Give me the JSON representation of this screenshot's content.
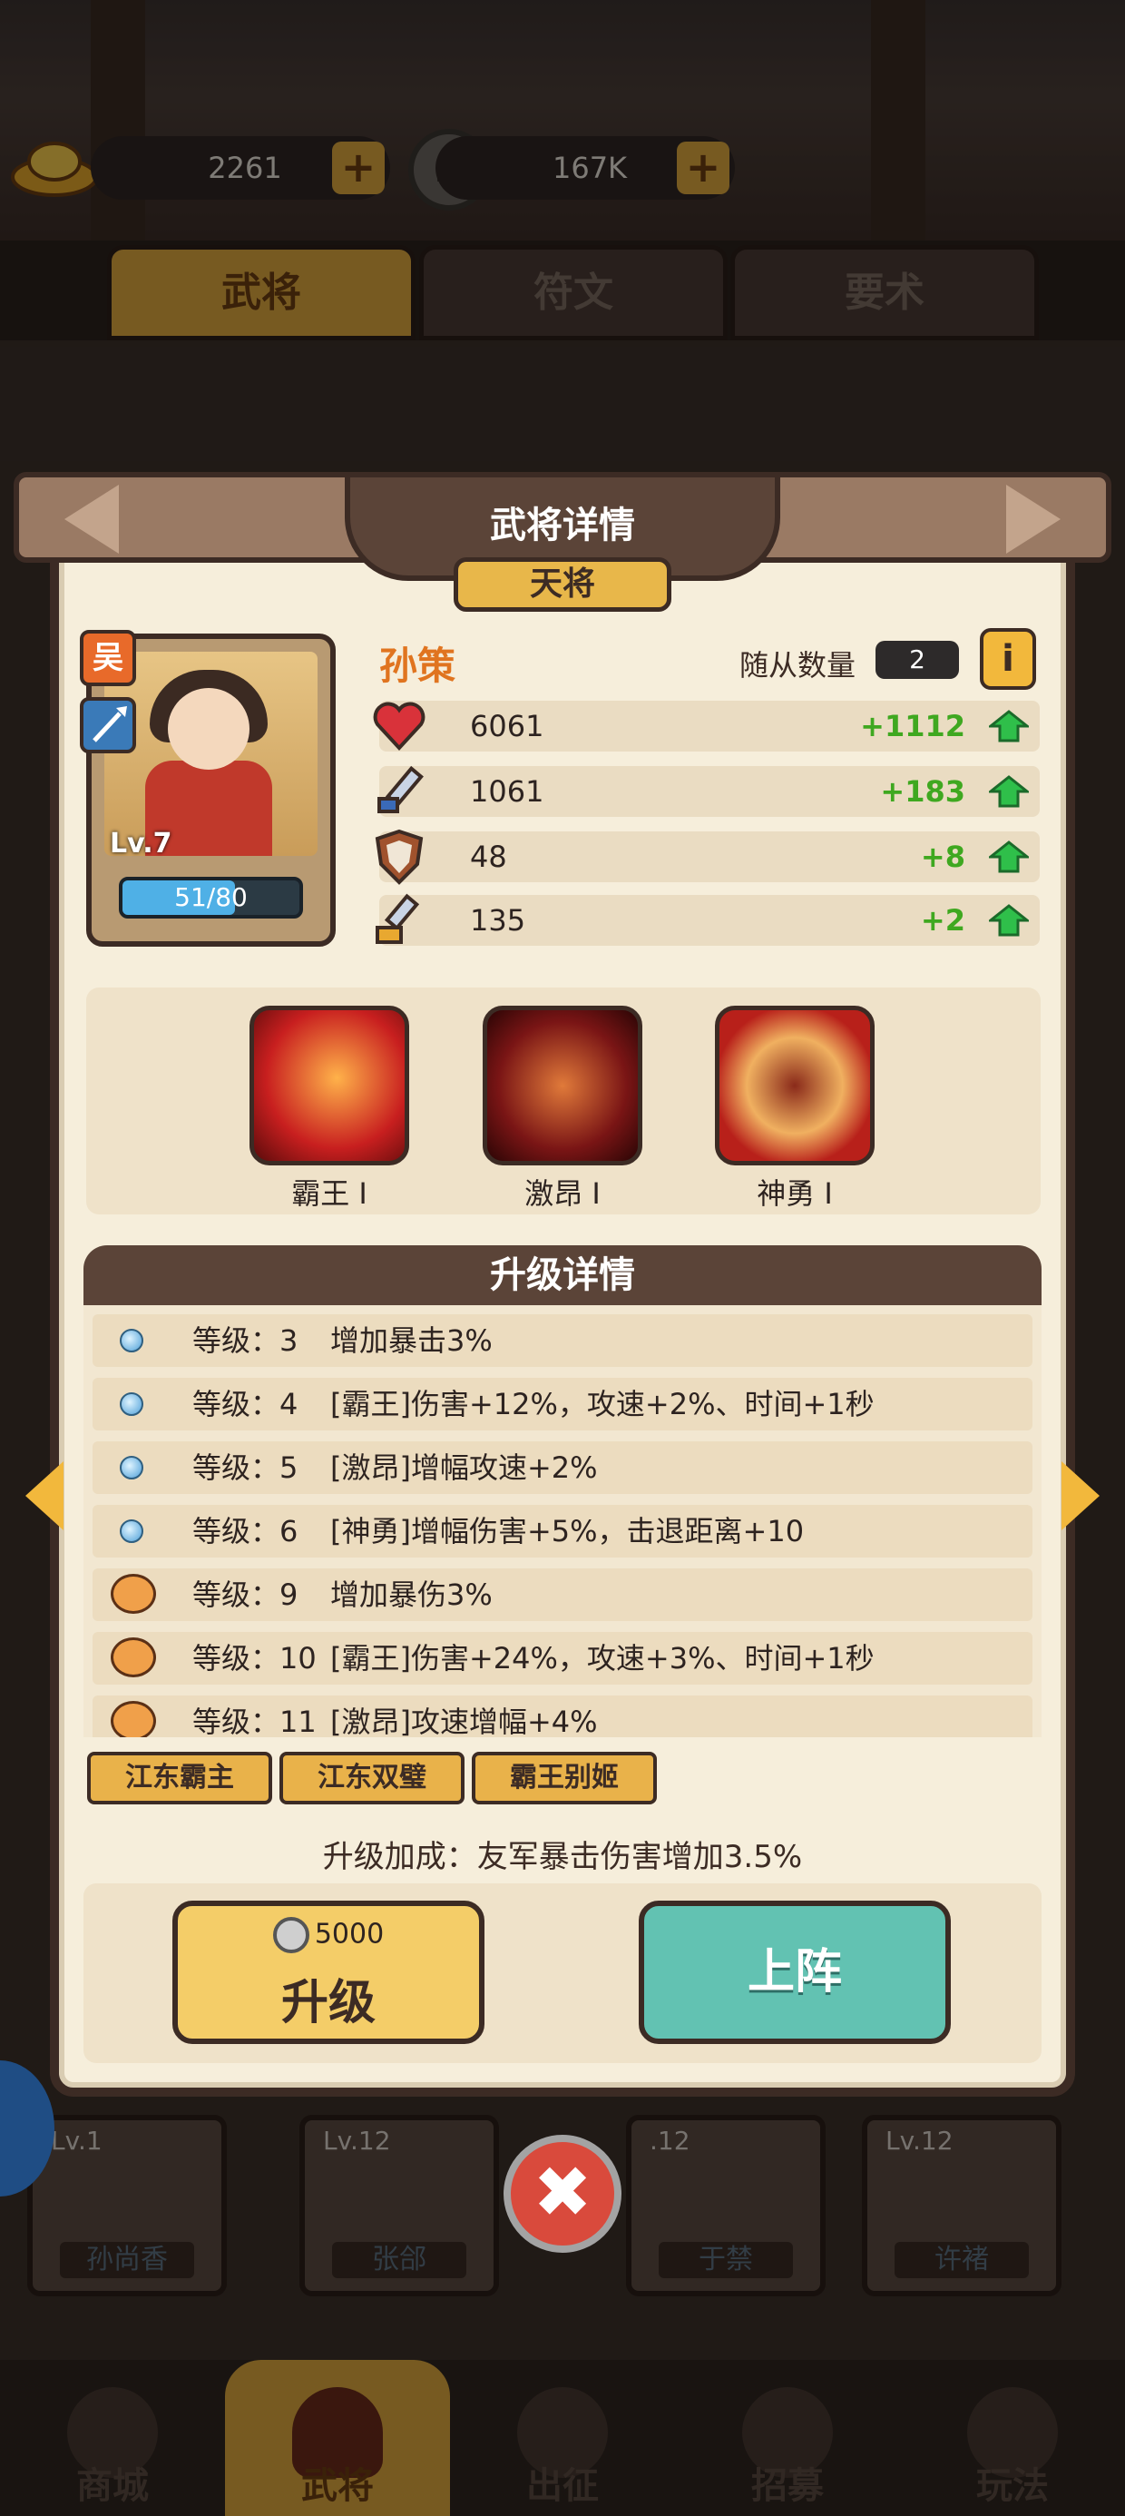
{
  "currency": {
    "gold": "2261",
    "coins": "167K",
    "plus_symbol": "+"
  },
  "tabs": [
    "武将",
    "符文",
    "要术"
  ],
  "background_cards": [
    {
      "level": "Lv.1",
      "name": "孙尚香"
    },
    {
      "level": "Lv.12",
      "name": "张郃"
    },
    {
      "level": ".12",
      "name": "于禁"
    },
    {
      "level": "Lv.12",
      "name": "许褚"
    }
  ],
  "bottom_nav": [
    "商城",
    "武将",
    "出征",
    "招募",
    "玩法"
  ],
  "dialog": {
    "title": "武将详情",
    "rank": "天将",
    "hero": {
      "faction": "吴",
      "name": "孙策",
      "level": "Lv.7",
      "exp_text": "51/80",
      "exp_fraction": 0.6375
    },
    "followers": {
      "label": "随从数量",
      "value": "2"
    },
    "info_icon": "i",
    "stats": [
      {
        "icon": "heart-icon",
        "value": "6061",
        "increase": "+1112"
      },
      {
        "icon": "sword-icon",
        "value": "1061",
        "increase": "+183"
      },
      {
        "icon": "shield-icon",
        "value": "48",
        "increase": "+8"
      },
      {
        "icon": "boot-icon",
        "value": "135",
        "increase": "+2"
      }
    ],
    "skills": [
      {
        "name": "霸王 I"
      },
      {
        "name": "激昂 I"
      },
      {
        "name": "神勇 I"
      }
    ],
    "upgrade_header": "升级详情",
    "upgrades": [
      {
        "icon": "blue-orb-icon",
        "level": "等级：3",
        "desc": "增加暴击3%"
      },
      {
        "icon": "blue-orb-icon",
        "level": "等级：4",
        "desc": "[霸王]伤害+12%，攻速+2%、时间+1秒"
      },
      {
        "icon": "blue-orb-icon",
        "level": "等级：5",
        "desc": "[激昂]增幅攻速+2%"
      },
      {
        "icon": "blue-orb-icon",
        "level": "等级：6",
        "desc": "[神勇]增幅伤害+5%，击退距离+10"
      },
      {
        "icon": "pig-icon",
        "level": "等级：9",
        "desc": "增加暴伤3%"
      },
      {
        "icon": "pig-icon",
        "level": "等级：10",
        "desc": "[霸王]伤害+24%，攻速+3%、时间+1秒"
      },
      {
        "icon": "pig-icon",
        "level": "等级：11",
        "desc": "[激昂]攻速增幅+4%"
      }
    ],
    "bond_tags": [
      "江东霸主",
      "江东双璧",
      "霸王别姬"
    ],
    "bonus_text": "升级加成：友军暴击伤害增加3.5%",
    "upgrade_button": {
      "cost": "5000",
      "label": "升级"
    },
    "deploy_button": {
      "label": "上阵"
    },
    "close_symbol": "✖"
  }
}
